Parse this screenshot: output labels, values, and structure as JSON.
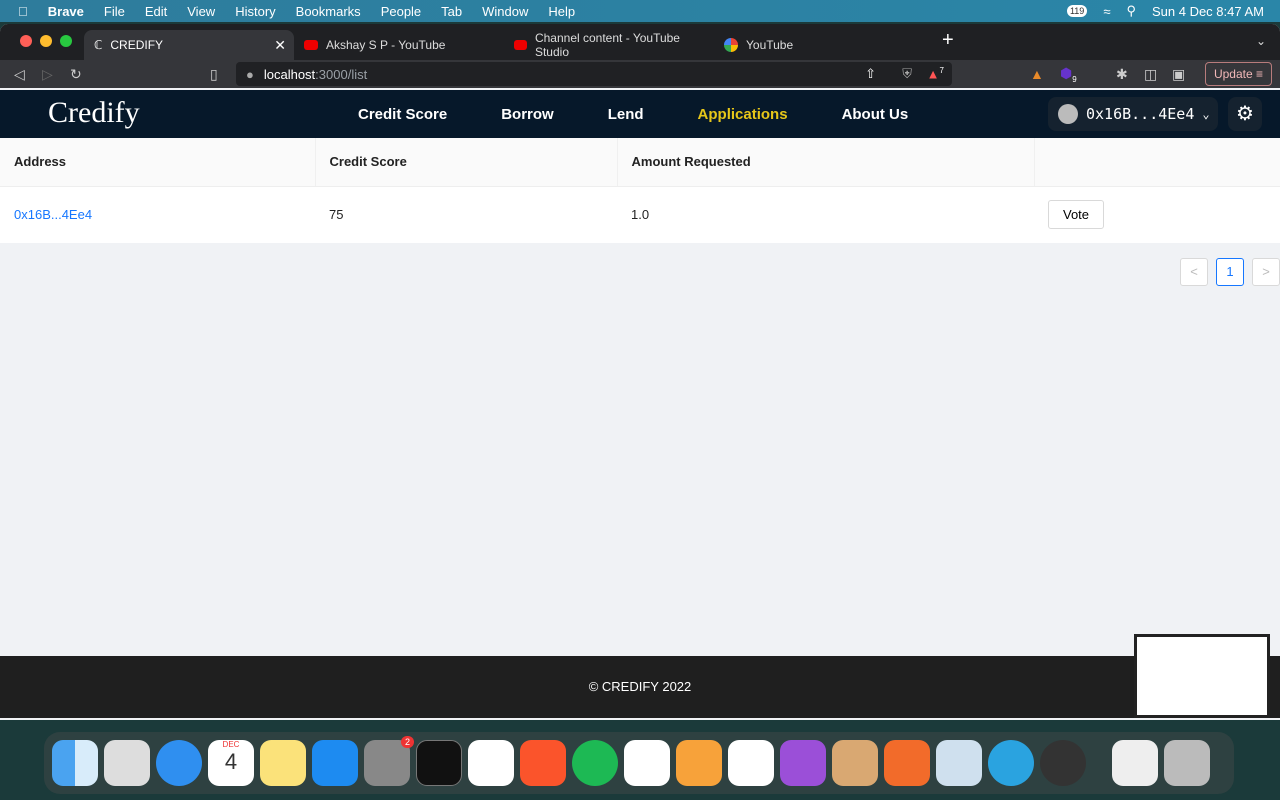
{
  "menubar": {
    "app": "Brave",
    "items": [
      "File",
      "Edit",
      "View",
      "History",
      "Bookmarks",
      "People",
      "Tab",
      "Window",
      "Help"
    ],
    "badge": "119",
    "datetime": "Sun 4 Dec  8:47 AM"
  },
  "tabs": [
    {
      "title": "CREDIFY",
      "active": true
    },
    {
      "title": "Akshay S P - YouTube"
    },
    {
      "title": "Channel content - YouTube Studio"
    },
    {
      "title": "YouTube"
    }
  ],
  "toolbar": {
    "url_host": "localhost",
    "url_path": ":3000/list",
    "shield_count": "7",
    "ext_badge": "9",
    "update_label": "Update"
  },
  "nav": {
    "logo": "Credify",
    "links": [
      "Credit Score",
      "Borrow",
      "Lend",
      "Applications",
      "About Us"
    ],
    "active": "Applications",
    "wallet": "0x16B...4Ee4",
    "active_color": "#e6c619"
  },
  "table": {
    "headers": [
      "Address",
      "Credit Score",
      "Amount Requested",
      ""
    ],
    "rows": [
      {
        "address": "0x16B...4Ee4",
        "score": "75",
        "amount": "1.0",
        "action": "Vote"
      }
    ]
  },
  "pagination": {
    "prev": "<",
    "current": "1",
    "next": ">"
  },
  "footer": "© CREDIFY 2022",
  "dock": {
    "calendar_month": "DEC",
    "calendar_day": "4",
    "settings_badge": "2"
  }
}
